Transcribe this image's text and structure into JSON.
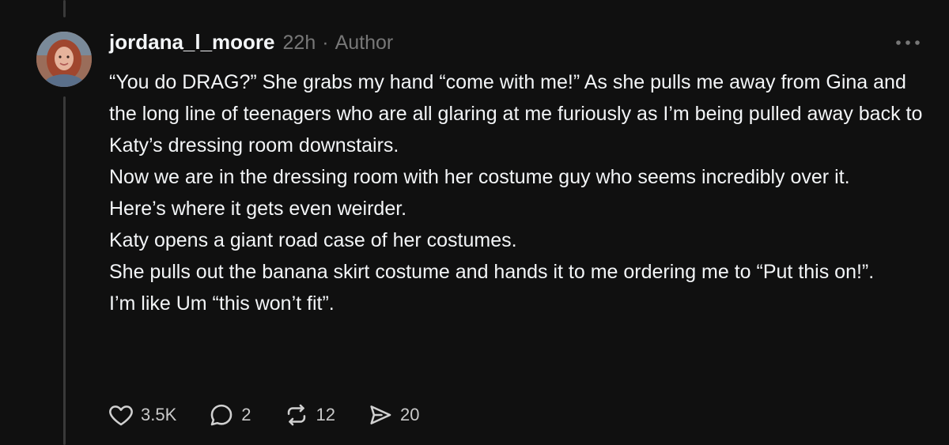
{
  "post": {
    "username": "jordana_l_moore",
    "time": "22h",
    "separator": "·",
    "author_label": "Author",
    "paragraphs": [
      "“You do DRAG?” She grabs my hand “come with me!” As she pulls me away from Gina and the long line of teenagers who are all glaring at me furiously as I’m being pulled away back to Katy’s dressing room downstairs.",
      "Now we are in the dressing room with her costume guy who seems incredibly over it.",
      "Here’s where it gets even weirder.",
      "Katy opens a giant road case of her costumes.",
      "She pulls out the banana skirt costume and hands it to me ordering me to “Put this on!”.",
      "I’m like Um “this won’t fit”."
    ]
  },
  "actions": {
    "likes": "3.5K",
    "replies": "2",
    "reposts": "12",
    "shares": "20"
  },
  "icons": {
    "like": "heart-icon",
    "reply": "speech-bubble-icon",
    "repost": "repost-icon",
    "share": "send-icon",
    "more": "more-dots-icon"
  },
  "colors": {
    "background": "#101010",
    "text": "#f3f5f7",
    "muted": "#777777",
    "thread_line": "#3a3a3a"
  }
}
